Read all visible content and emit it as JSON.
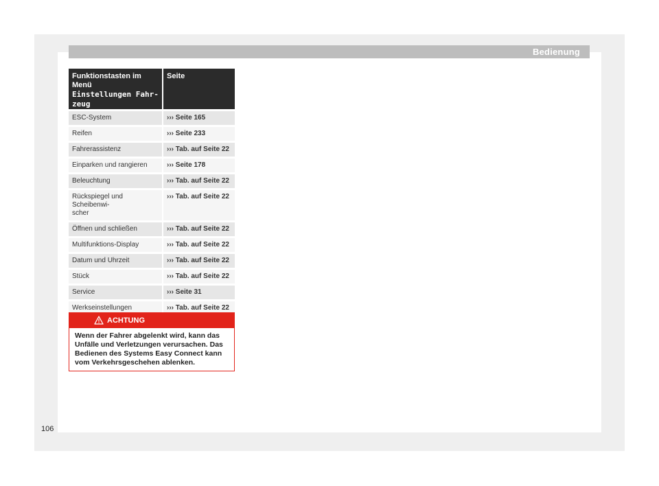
{
  "header": {
    "title": "Bedienung"
  },
  "table": {
    "col1_header_plain": "Funktionstasten im Menü",
    "col1_header_mono": "Einstellungen Fahr-zeug",
    "col1_header_mono_a": "Einstellungen Fahr-",
    "col1_header_mono_b": "zeug",
    "col2_header": "Seite",
    "arrow": "›››",
    "rows": [
      {
        "label": "ESC-System",
        "ref": "Seite 165"
      },
      {
        "label": "Reifen",
        "ref": "Seite 233"
      },
      {
        "label": "Fahrerassistenz",
        "ref": "Tab. auf Seite 22"
      },
      {
        "label": "Einparken und rangieren",
        "ref": "Seite 178"
      },
      {
        "label": "Beleuchtung",
        "ref": "Tab. auf Seite 22"
      },
      {
        "label": "Rückspiegel und Scheibenwi-scher",
        "label_a": "Rückspiegel und Scheibenwi-",
        "label_b": "scher",
        "ref": "Tab. auf Seite 22"
      },
      {
        "label": "Öffnen und schließen",
        "ref": "Tab. auf Seite 22"
      },
      {
        "label": "Multifunktions-Display",
        "ref": "Tab. auf Seite 22"
      },
      {
        "label": "Datum und Uhrzeit",
        "ref": "Tab. auf Seite 22"
      },
      {
        "label": "Stück",
        "ref": "Tab. auf Seite 22"
      },
      {
        "label": "Service",
        "ref": "Seite 31"
      },
      {
        "label": "Werkseinstellungen",
        "ref": "Tab. auf Seite 22"
      }
    ]
  },
  "warning": {
    "icon": "warning-triangle-icon",
    "title": "ACHTUNG",
    "text": "Wenn der Fahrer abgelenkt wird, kann das Unfälle und Verletzungen verursachen. Das Bedienen des Systems Easy Connect kann vom Verkehrsgeschehen ablenken.",
    "accent": "#e2231a"
  },
  "page_number": "106"
}
